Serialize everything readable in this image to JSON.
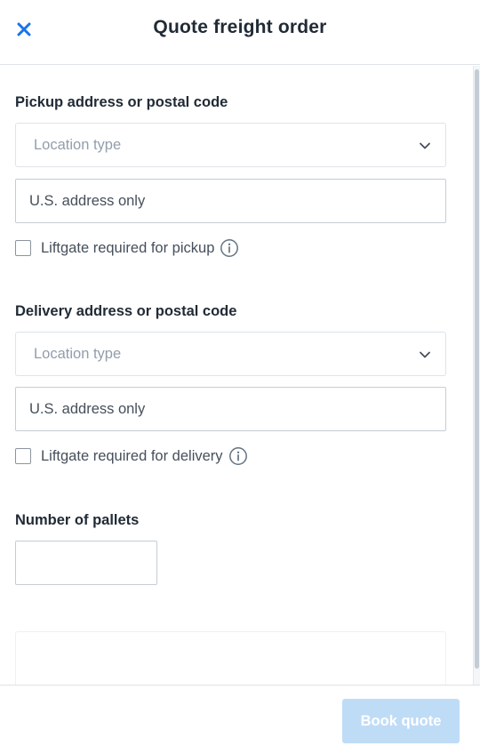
{
  "header": {
    "title": "Quote freight order",
    "close_icon": "close-icon",
    "accent_color": "#1a73e8"
  },
  "pickup": {
    "label": "Pickup address or postal code",
    "location_type_placeholder": "Location type",
    "address_placeholder": "U.S. address only",
    "liftgate_label": "Liftgate required for pickup",
    "liftgate_checked": false
  },
  "delivery": {
    "label": "Delivery address or postal code",
    "location_type_placeholder": "Location type",
    "address_placeholder": "U.S. address only",
    "liftgate_label": "Liftgate required for delivery",
    "liftgate_checked": false
  },
  "pallets": {
    "label": "Number of pallets",
    "value": ""
  },
  "footer": {
    "book_label": "Book quote",
    "book_enabled": false,
    "book_color": "#bfdcf7"
  }
}
